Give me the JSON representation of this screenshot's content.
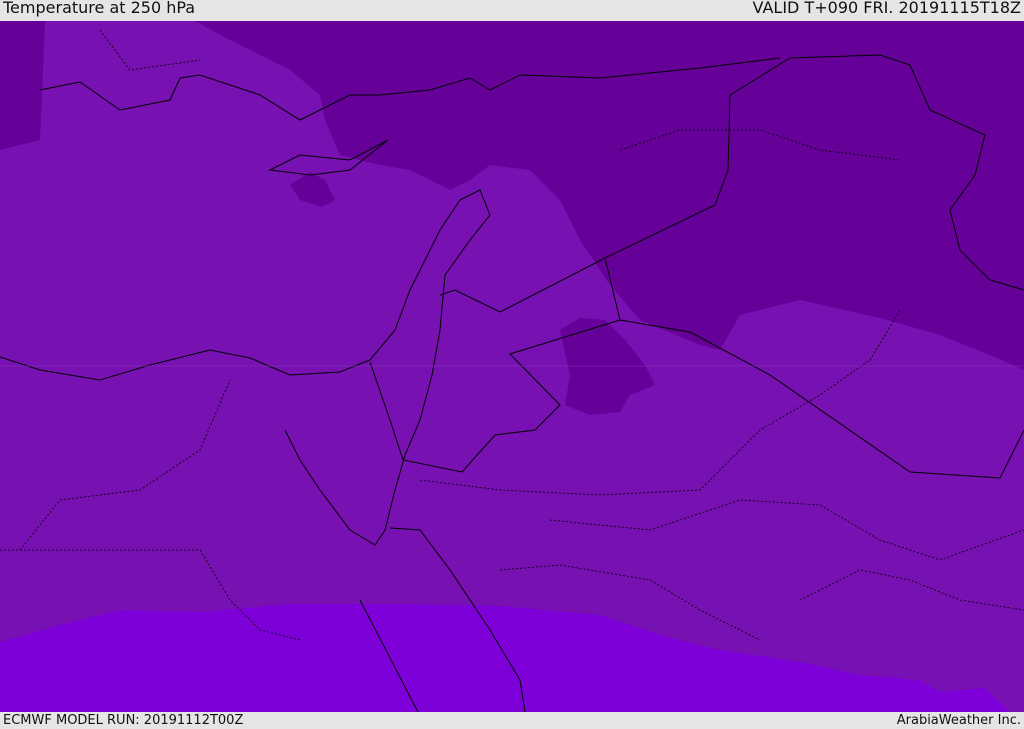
{
  "header": {
    "title": "Temperature at 250 hPa",
    "valid": "VALID T+090 FRI. 20191115T18Z"
  },
  "footer": {
    "model_run": "ECMWF MODEL RUN: 20191112T00Z",
    "credit": "ArabiaWeather Inc."
  },
  "colors": {
    "cold": "#650099",
    "mid": "#7711b1",
    "warm": "#7e00d8",
    "lines": "#000000"
  }
}
